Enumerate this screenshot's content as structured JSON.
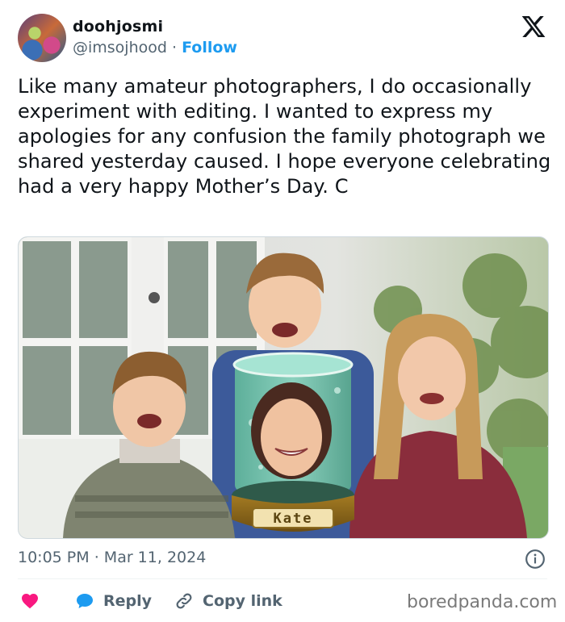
{
  "author": {
    "display_name": "doohjosmi",
    "handle": "@imsojhood",
    "separator": "·",
    "follow_label": "Follow"
  },
  "tweet": {
    "text": "Like many amateur photographers, I do occasionally experiment with editing. I wanted to express my apologies for any confusion the family photograph we shared yesterday caused. I hope everyone celebrating had a very happy Mother’s Day. C",
    "time": "10:05 PM",
    "date_separator": "·",
    "date": "Mar 11, 2024",
    "jar_label": "Kate"
  },
  "actions": {
    "reply_label": "Reply",
    "copy_link_label": "Copy link"
  },
  "watermark": "boredpanda.com",
  "colors": {
    "accent": "#1d9bf0",
    "like": "#f91880",
    "muted": "#536471"
  },
  "icons": [
    "x-logo-icon",
    "heart-icon",
    "reply-bubble-icon",
    "link-icon",
    "info-icon"
  ]
}
